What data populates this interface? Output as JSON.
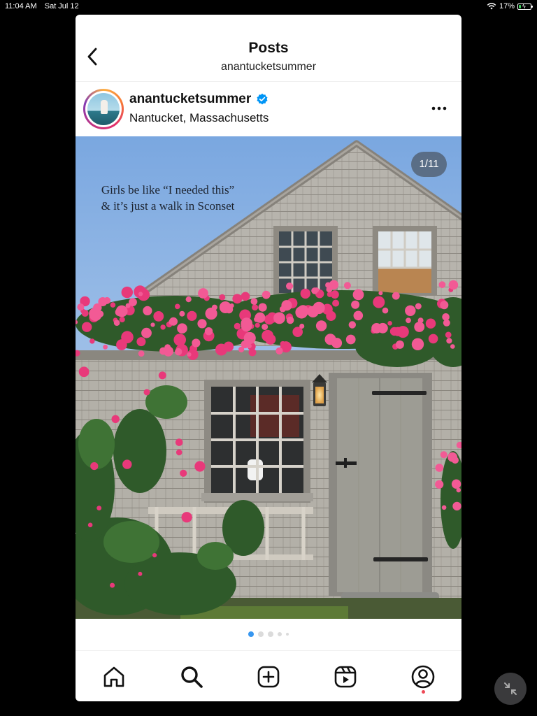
{
  "status_bar": {
    "time": "11:04 AM",
    "date": "Sat Jul 12",
    "battery": "17%",
    "battery_level": 0.17,
    "icons": [
      "wifi-icon",
      "battery-charging-icon"
    ]
  },
  "nav": {
    "title": "Posts",
    "subtitle": "anantucketsummer",
    "back_icon": "chevron-left-icon"
  },
  "post": {
    "username": "anantucketsummer",
    "verified": true,
    "location": "Nantucket, Massachusetts",
    "more_icon": "more-horizontal-icon",
    "counter": "1/11",
    "caption_line1": "Girls be like “I needed this”",
    "caption_line2": "& it’s just a walk in Sconset",
    "carousel_total_dots": 5,
    "carousel_active_index": 0
  },
  "tabbar": {
    "items": [
      {
        "name": "home",
        "icon": "home-icon"
      },
      {
        "name": "search",
        "icon": "search-icon"
      },
      {
        "name": "create",
        "icon": "plus-square-icon"
      },
      {
        "name": "reels",
        "icon": "reels-icon"
      },
      {
        "name": "profile",
        "icon": "profile-icon",
        "notification": true
      }
    ]
  },
  "colors": {
    "accent_blue": "#3897f0",
    "verified_blue": "#0095f6",
    "notification_red": "#ed4956",
    "rose_pink": "#e8397a"
  },
  "overlay": {
    "minimize_icon": "minimize-arrows-icon"
  }
}
